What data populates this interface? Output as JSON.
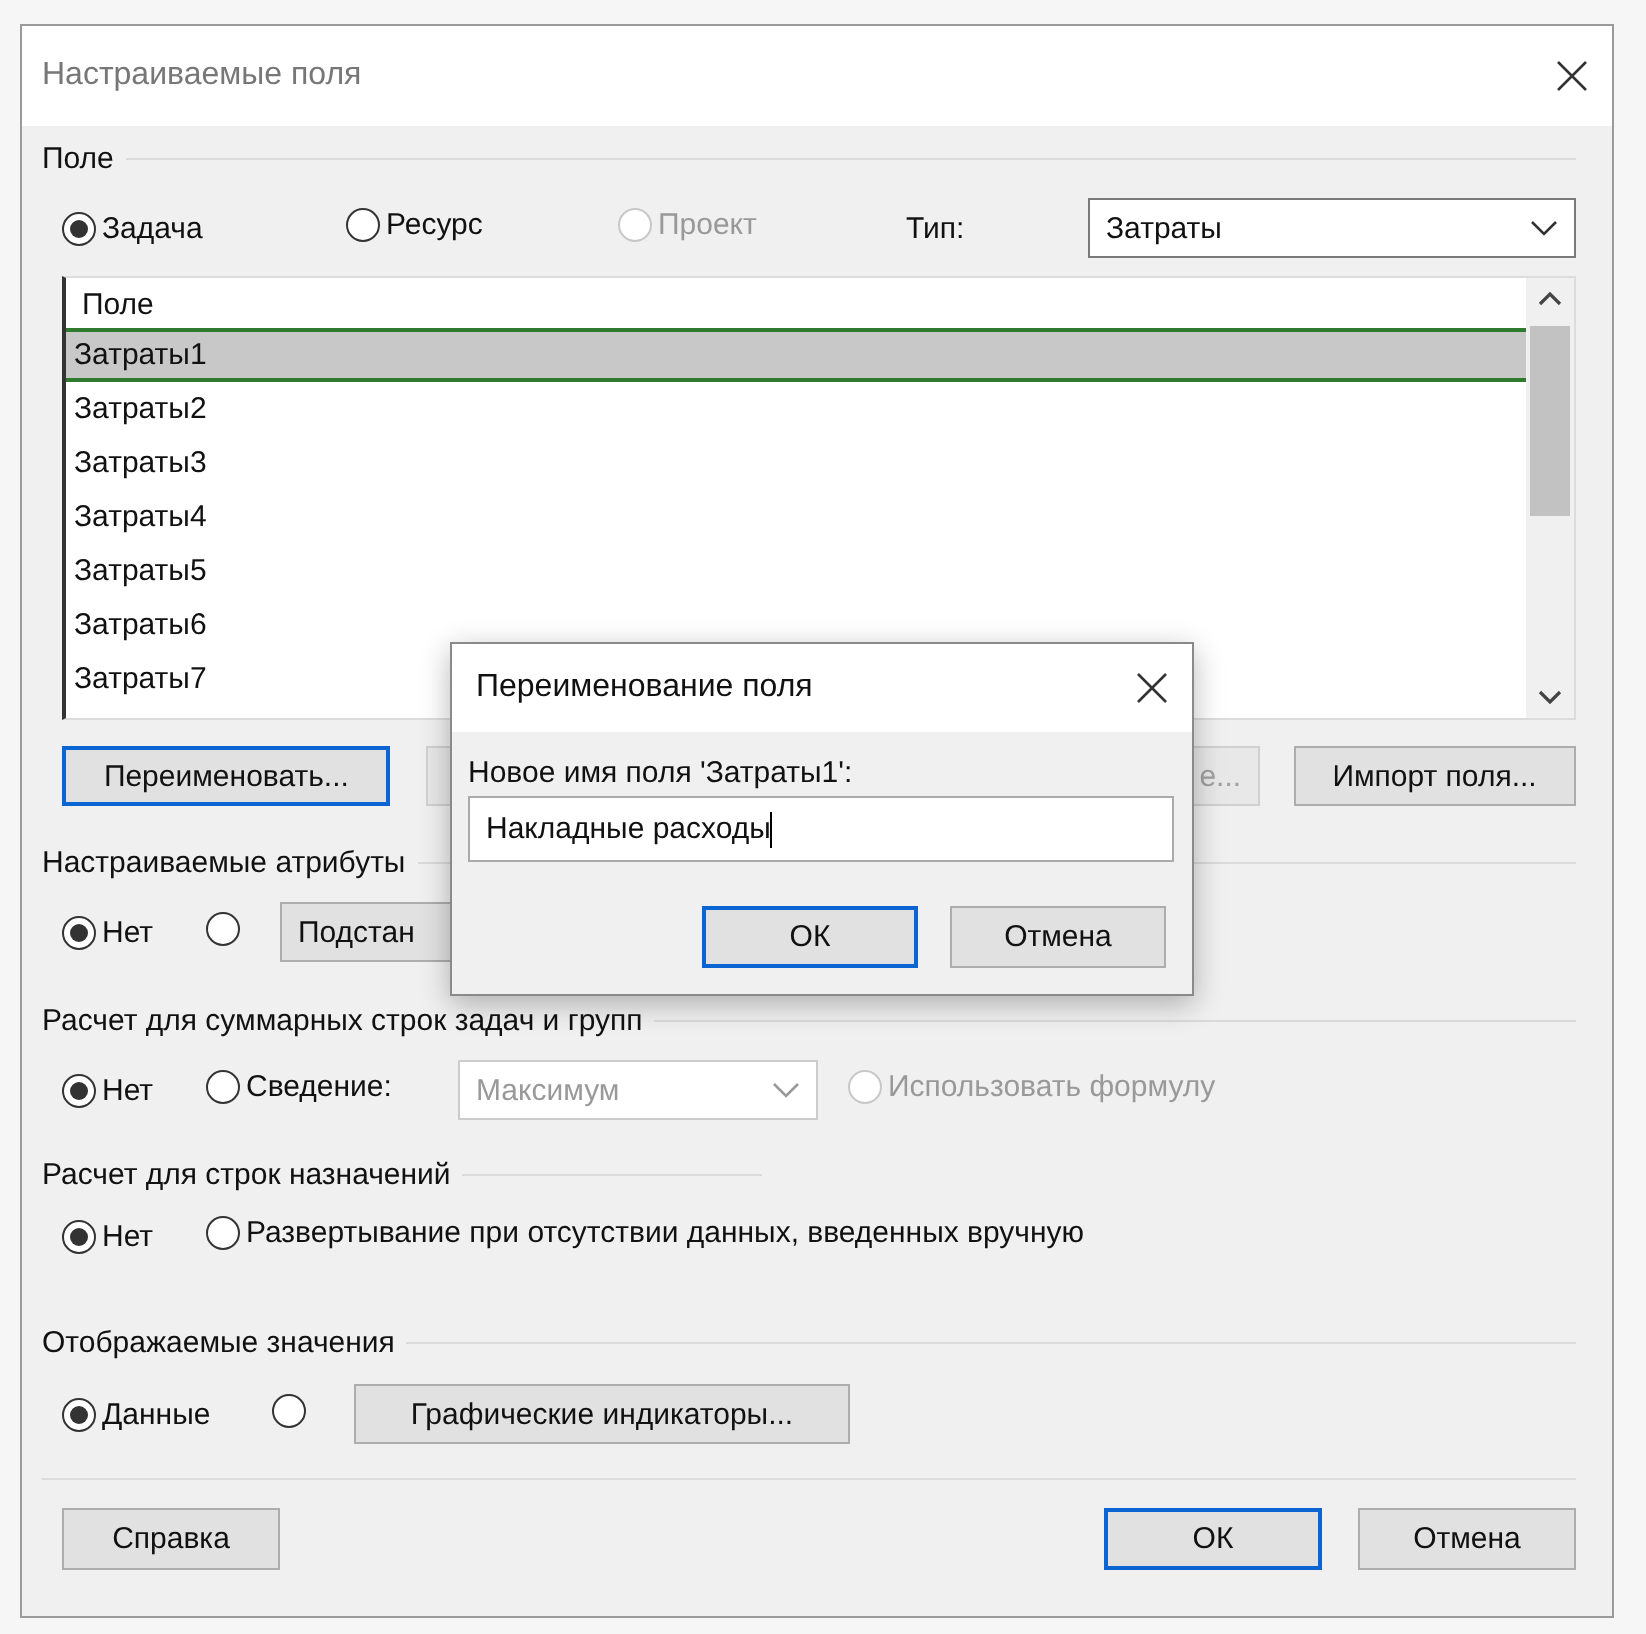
{
  "window": {
    "title": "Настраиваемые поля"
  },
  "field_group": {
    "title": "Поле",
    "options": [
      {
        "label": "Задача",
        "selected": true,
        "disabled": false
      },
      {
        "label": "Ресурс",
        "selected": false,
        "disabled": false
      },
      {
        "label": "Проект",
        "selected": false,
        "disabled": true
      }
    ],
    "type_label": "Тип:",
    "type_value": "Затраты"
  },
  "field_list": {
    "header": "Поле",
    "rows": [
      {
        "label": "Затраты1",
        "selected": true
      },
      {
        "label": "Затраты2",
        "selected": false
      },
      {
        "label": "Затраты3",
        "selected": false
      },
      {
        "label": "Затраты4",
        "selected": false
      },
      {
        "label": "Затраты5",
        "selected": false
      },
      {
        "label": "Затраты6",
        "selected": false
      },
      {
        "label": "Затраты7",
        "selected": false
      }
    ]
  },
  "list_buttons": [
    {
      "label": "Переименовать...",
      "focused": true,
      "disabled": false
    },
    {
      "label": "е...",
      "focused": false,
      "disabled": true
    },
    {
      "label": "Импорт поля...",
      "focused": false,
      "disabled": false
    }
  ],
  "custom_attributes": {
    "title": "Настраиваемые атрибуты",
    "options": [
      {
        "label": "Нет",
        "selected": true
      },
      {
        "selected": false
      }
    ],
    "button": "Подстан"
  },
  "summary_calc": {
    "title": "Расчет для суммарных строк задач и групп",
    "options": [
      {
        "label": "Нет",
        "selected": true
      },
      {
        "label": "Сведение:",
        "selected": false
      }
    ],
    "dropdown": {
      "value": "Максимум",
      "disabled": true
    },
    "formula_option": {
      "label": "Использовать формулу",
      "selected": false,
      "disabled": true
    }
  },
  "assignment_calc": {
    "title": "Расчет для строк назначений",
    "options": [
      {
        "label": "Нет",
        "selected": true
      },
      {
        "label": "Развертывание при отсутствии данных, введенных вручную",
        "selected": false
      }
    ]
  },
  "display_values": {
    "title": "Отображаемые значения",
    "options": [
      {
        "label": "Данные",
        "selected": true
      },
      {
        "selected": false
      }
    ],
    "button": "Графические индикаторы..."
  },
  "footer_buttons": [
    {
      "label": "Справка",
      "focused": false
    },
    {
      "label": "ОК",
      "focused": true
    },
    {
      "label": "Отмена",
      "focused": false
    }
  ],
  "rename_dialog": {
    "title": "Переименование поля",
    "label": "Новое имя поля 'Затраты1':",
    "value": "Накладные расходы",
    "buttons": [
      {
        "label": "ОК",
        "focused": true
      },
      {
        "label": "Отмена",
        "focused": false
      }
    ]
  }
}
